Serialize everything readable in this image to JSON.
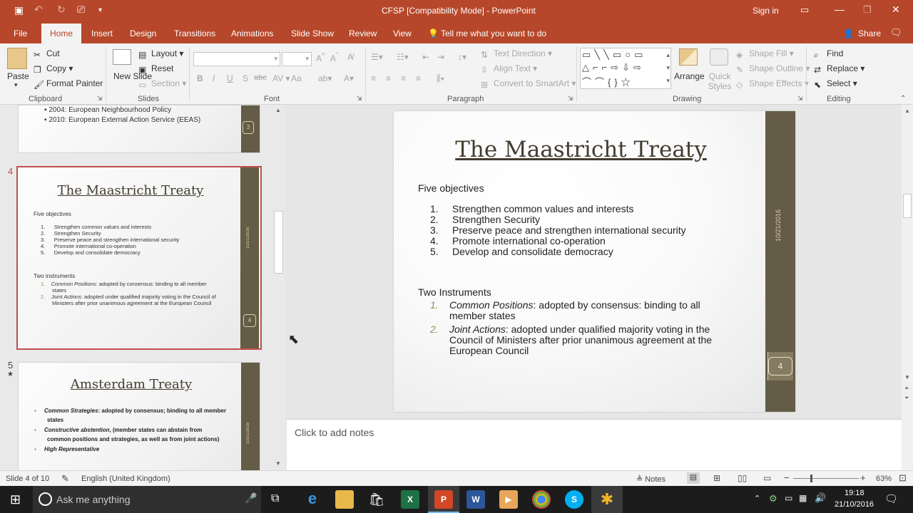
{
  "window": {
    "title": "CFSP [Compatibility Mode]  -  PowerPoint",
    "signin": "Sign in"
  },
  "tabs": [
    "File",
    "Home",
    "Insert",
    "Design",
    "Transitions",
    "Animations",
    "Slide Show",
    "Review",
    "View"
  ],
  "tell_me": "Tell me what you want to do",
  "share": "Share",
  "ribbon": {
    "clipboard": {
      "paste": "Paste",
      "cut": "Cut",
      "copy": "Copy",
      "format_painter": "Format Painter",
      "label": "Clipboard"
    },
    "slides": {
      "new_slide": "New Slide",
      "layout": "Layout",
      "reset": "Reset",
      "section": "Section",
      "label": "Slides"
    },
    "font": {
      "label": "Font",
      "bold": "B",
      "italic": "I",
      "underline": "U",
      "strike": "S",
      "shadow": "abc",
      "aa": "Aa"
    },
    "paragraph": {
      "text_direction": "Text Direction",
      "align_text": "Align Text",
      "convert_smartart": "Convert to SmartArt",
      "label": "Paragraph"
    },
    "drawing": {
      "arrange": "Arrange",
      "quick_styles": "Quick Styles",
      "shape_fill": "Shape Fill",
      "shape_outline": "Shape Outline",
      "shape_effects": "Shape Effects",
      "label": "Drawing"
    },
    "editing": {
      "find": "Find",
      "replace": "Replace",
      "select": "Select",
      "label": "Editing"
    }
  },
  "thumbs": {
    "t3": {
      "number": "3",
      "items": [
        "2004: European Neighbourhood Policy",
        "2010: European External Action Service (EEAS)"
      ]
    },
    "t4": {
      "number": "4",
      "title": "The Maastricht Treaty",
      "sub": "Five objectives",
      "items": [
        "Strengthen common values and interests",
        "Strengthen Security",
        "Preserve peace and strengthen international security",
        "Promote international co-operation",
        "Develop and consolidate democracy"
      ],
      "sub2": "Two instruments",
      "inst": [
        {
          "em": "Common Positions",
          "rest": ": adopted by consensus: binding to all member states"
        },
        {
          "em": "Joint Actions",
          "rest": ": adopted under qualified majority voting in the Council of Ministers after prior unanimous agreement at the European Council"
        }
      ],
      "date": "10/21/2016"
    },
    "t5": {
      "number": "5",
      "star": "★",
      "title": "Amsterdam Treaty",
      "items": [
        {
          "em": "Common Strategies",
          "rest": ": adopted by consensus; binding to all member states"
        },
        {
          "em": "Constructive abstention",
          "rest": ", (member states can abstain from common positions and strategies, as well as from joint actions)"
        },
        {
          "em": "High Representative",
          "rest": ""
        }
      ],
      "date": "10/21/2016"
    }
  },
  "slide": {
    "title": "The Maastricht Treaty",
    "sub": "Five objectives",
    "objectives": [
      "Strengthen common values and interests",
      "Strengthen Security",
      "Preserve peace and strengthen international security",
      "Promote international co-operation",
      "Develop and consolidate democracy"
    ],
    "sub2": "Two Instruments",
    "instruments": [
      {
        "n": "1.",
        "em": "Common Positions",
        "rest": ": adopted by consensus: binding to all",
        "rest2": "member states"
      },
      {
        "n": "2.",
        "em": "Joint Actions",
        "rest": ": adopted under qualified majority voting in the",
        "rest2": "Council of Ministers after prior unanimous agreement at the",
        "rest3": "European Council"
      }
    ],
    "date": "10/21/2016",
    "page": "4"
  },
  "notes_placeholder": "Click to add notes",
  "status": {
    "slide": "Slide 4 of 10",
    "language": "English (United Kingdom)",
    "notes": "Notes",
    "zoom": "63%"
  },
  "taskbar": {
    "search": "Ask me anything",
    "time": "19:18",
    "date": "21/10/2016"
  },
  "colors": {
    "accent": "#b7472a",
    "band": "#655c47"
  }
}
